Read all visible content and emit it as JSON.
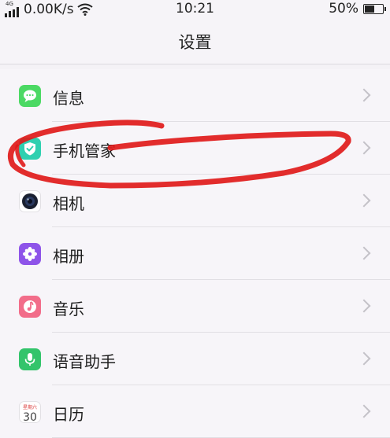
{
  "status_bar": {
    "network_type": "4G",
    "speed": "0.00K/s",
    "time": "10:21",
    "battery": "50%",
    "battery_level": 0.5,
    "icons": [
      "signal-icon",
      "wifi-icon",
      "battery-icon"
    ]
  },
  "nav": {
    "title": "设置"
  },
  "settings": {
    "items": [
      {
        "label": "信息",
        "icon": "message-icon",
        "color": "#4cd964"
      },
      {
        "label": "手机管家",
        "icon": "shield-icon",
        "color": "#2fd0b0"
      },
      {
        "label": "相机",
        "icon": "camera-icon",
        "color": "#ffffff"
      },
      {
        "label": "相册",
        "icon": "photos-icon",
        "color": "#8e54e9"
      },
      {
        "label": "音乐",
        "icon": "music-icon",
        "color": "#f26d8a"
      },
      {
        "label": "语音助手",
        "icon": "microphone-icon",
        "color": "#33c46b"
      },
      {
        "label": "日历",
        "icon": "calendar-icon",
        "color": "#ffffff",
        "icon_top": "星期六",
        "icon_day": "30"
      }
    ]
  },
  "annotation": {
    "color": "#e01a1a",
    "type": "hand-drawn red circle around 手机管家"
  }
}
